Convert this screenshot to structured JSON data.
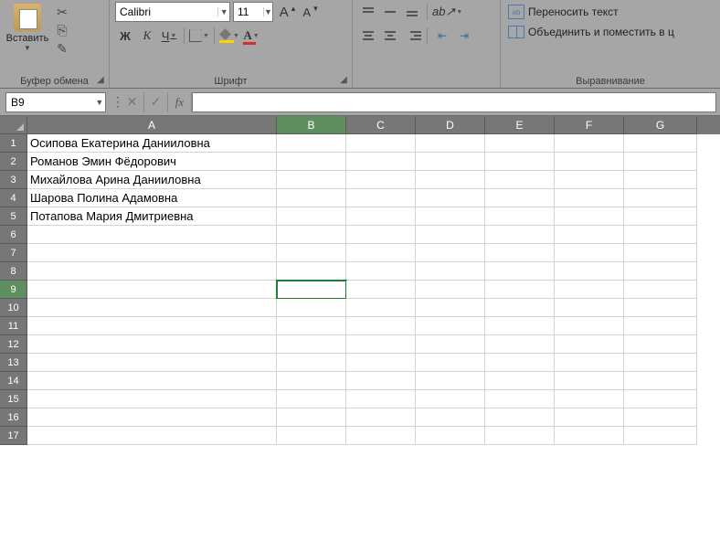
{
  "ribbon": {
    "clipboard": {
      "paste_label": "Вставить",
      "group_label": "Буфер обмена"
    },
    "font": {
      "name": "Calibri",
      "size": "11",
      "bold": "Ж",
      "italic": "К",
      "underline": "Ч",
      "group_label": "Шрифт"
    },
    "alignment": {
      "wrap_label": "Переносить текст",
      "merge_label": "Объединить и поместить в ц",
      "group_label": "Выравнивание"
    }
  },
  "namebox": "B9",
  "fx_label": "fx",
  "formula": "",
  "columns": [
    "A",
    "B",
    "C",
    "D",
    "E",
    "F",
    "G"
  ],
  "row_count": 17,
  "active_cell": {
    "row": 9,
    "col": "B"
  },
  "cells": {
    "A1": "Осипова Екатерина Данииловна",
    "A2": "Романов Эмин Фёдорович",
    "A3": "Михайлова Арина Данииловна",
    "A4": "Шарова Полина Адамовна",
    "A5": "Потапова Мария Дмитриевна"
  }
}
